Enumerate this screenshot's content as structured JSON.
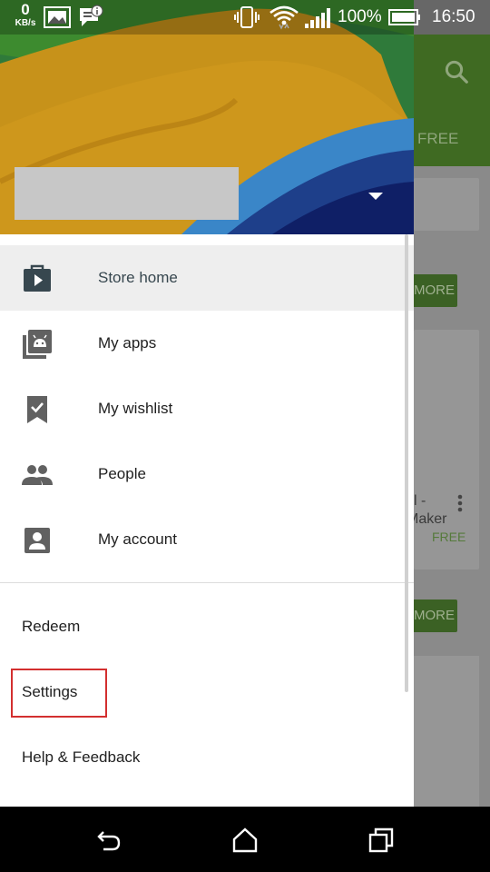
{
  "status_bar": {
    "speed_value": "0",
    "speed_unit": "KB/s",
    "battery_percent": "100%",
    "time": "16:50",
    "icons": [
      "image-icon",
      "chat-info-icon",
      "vibrate-icon",
      "wifi-icon",
      "signal-icon",
      "battery-icon"
    ]
  },
  "background": {
    "tab_free": "FREE",
    "more_button_1": "MORE",
    "more_button_2": "MORE",
    "card_title_line1": "l -",
    "card_title_line2": "Maker",
    "card_price": "FREE"
  },
  "drawer": {
    "account_dropdown_icon": "arrow-drop-down-icon",
    "nav_items": [
      {
        "label": "Store home",
        "icon": "store-bag-icon",
        "active": true
      },
      {
        "label": "My apps",
        "icon": "my-apps-icon",
        "active": false
      },
      {
        "label": "My wishlist",
        "icon": "wishlist-bookmark-icon",
        "active": false
      },
      {
        "label": "People",
        "icon": "people-icon",
        "active": false
      },
      {
        "label": "My account",
        "icon": "account-box-icon",
        "active": false
      }
    ],
    "menu_items": [
      {
        "label": "Redeem"
      },
      {
        "label": "Settings",
        "highlighted": true
      },
      {
        "label": "Help & Feedback"
      }
    ]
  },
  "colors": {
    "toolbar_green": "#3f6a22",
    "active_item_bg": "#eeeeee",
    "highlight_red": "#d32f2f",
    "icon_gray": "#37474f"
  }
}
